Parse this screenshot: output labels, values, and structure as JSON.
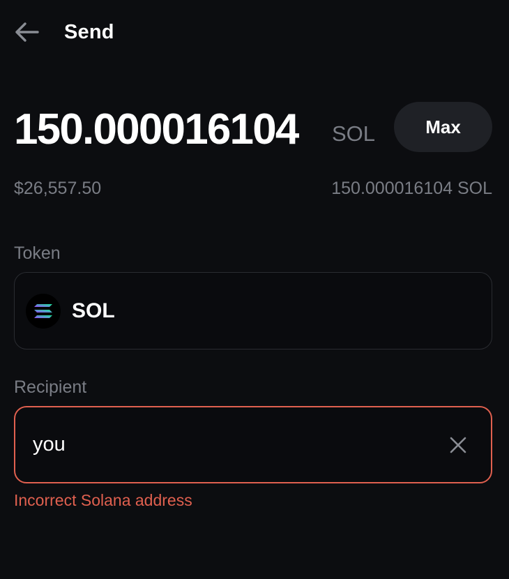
{
  "header": {
    "back_icon": "arrow-left-icon",
    "title": "Send"
  },
  "amount": {
    "value": "150.000016104",
    "unit": "SOL",
    "max_label": "Max"
  },
  "fiat_value": "$26,557.50",
  "balance": "150.000016104 SOL",
  "token": {
    "label": "Token",
    "selected": "SOL",
    "icon": "solana-logo-icon"
  },
  "recipient": {
    "label": "Recipient",
    "value": "you",
    "clear_icon": "close-icon",
    "error": "Incorrect Solana address"
  },
  "colors": {
    "background": "#0c0d10",
    "muted_text": "#7a7d85",
    "error": "#e0604f",
    "button_bg": "#1f2126"
  }
}
